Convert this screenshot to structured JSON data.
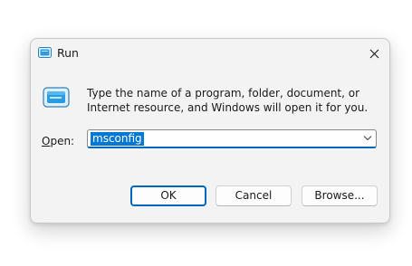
{
  "window": {
    "title": "Run",
    "title_icon": "run-app-icon",
    "close_icon": "close-icon"
  },
  "content": {
    "icon": "run-app-icon",
    "description": "Type the name of a program, folder, document, or Internet resource, and Windows will open it for you.",
    "open_label_accel": "O",
    "open_label_rest": "pen:",
    "input_value": "msconfig",
    "dropdown_icon": "chevron-down-icon"
  },
  "buttons": {
    "ok": "OK",
    "cancel": "Cancel",
    "browse": "Browse..."
  },
  "colors": {
    "accent": "#0067c0",
    "selection": "#0078d4",
    "dialog_bg": "#f3f3f3"
  }
}
